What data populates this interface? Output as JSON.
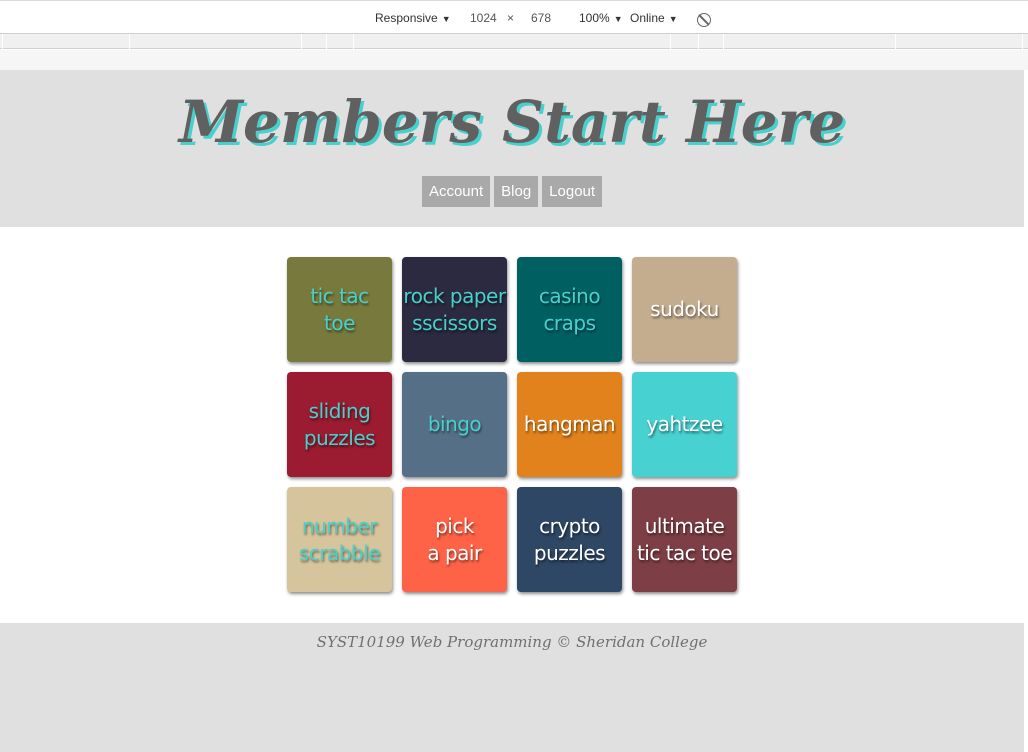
{
  "devtools": {
    "device": "Responsive",
    "width": "1024",
    "times": "×",
    "height": "678",
    "zoom": "100%",
    "network": "Online",
    "rotate_icon": "rotate-icon"
  },
  "header": {
    "title": "Members Start Here",
    "nav": [
      "Account",
      "Blog",
      "Logout"
    ]
  },
  "games": [
    {
      "label": "tic tac\ntoe",
      "bg": "#777a3c",
      "fg": "#48d1cc"
    },
    {
      "label": "rock paper\nsscissors",
      "bg": "#2b2a40",
      "fg": "#48d1cc"
    },
    {
      "label": "casino\ncraps",
      "bg": "#005f61",
      "fg": "#48d1cc"
    },
    {
      "label": "sudoku",
      "bg": "#c4ac8f",
      "fg": "#ffffff"
    },
    {
      "label": "sliding\npuzzles",
      "bg": "#9b1b30",
      "fg": "#48d1cc"
    },
    {
      "label": "bingo",
      "bg": "#557086",
      "fg": "#48d1cc"
    },
    {
      "label": "hangman",
      "bg": "#e2821d",
      "fg": "#ffffff"
    },
    {
      "label": "yahtzee",
      "bg": "#48d1d1",
      "fg": "#ffffff"
    },
    {
      "label": "number\nscrabble",
      "bg": "#d6c49c",
      "fg": "#48d1cc"
    },
    {
      "label": "pick\na pair",
      "bg": "#ff6347",
      "fg": "#ffffff"
    },
    {
      "label": "crypto\npuzzles",
      "bg": "#2e4764",
      "fg": "#ffffff"
    },
    {
      "label": "ultimate\ntic tac toe",
      "bg": "#7d3e45",
      "fg": "#ffffff"
    }
  ],
  "footer": {
    "text": "SYST10199 Web Programming © Sheridan College"
  }
}
